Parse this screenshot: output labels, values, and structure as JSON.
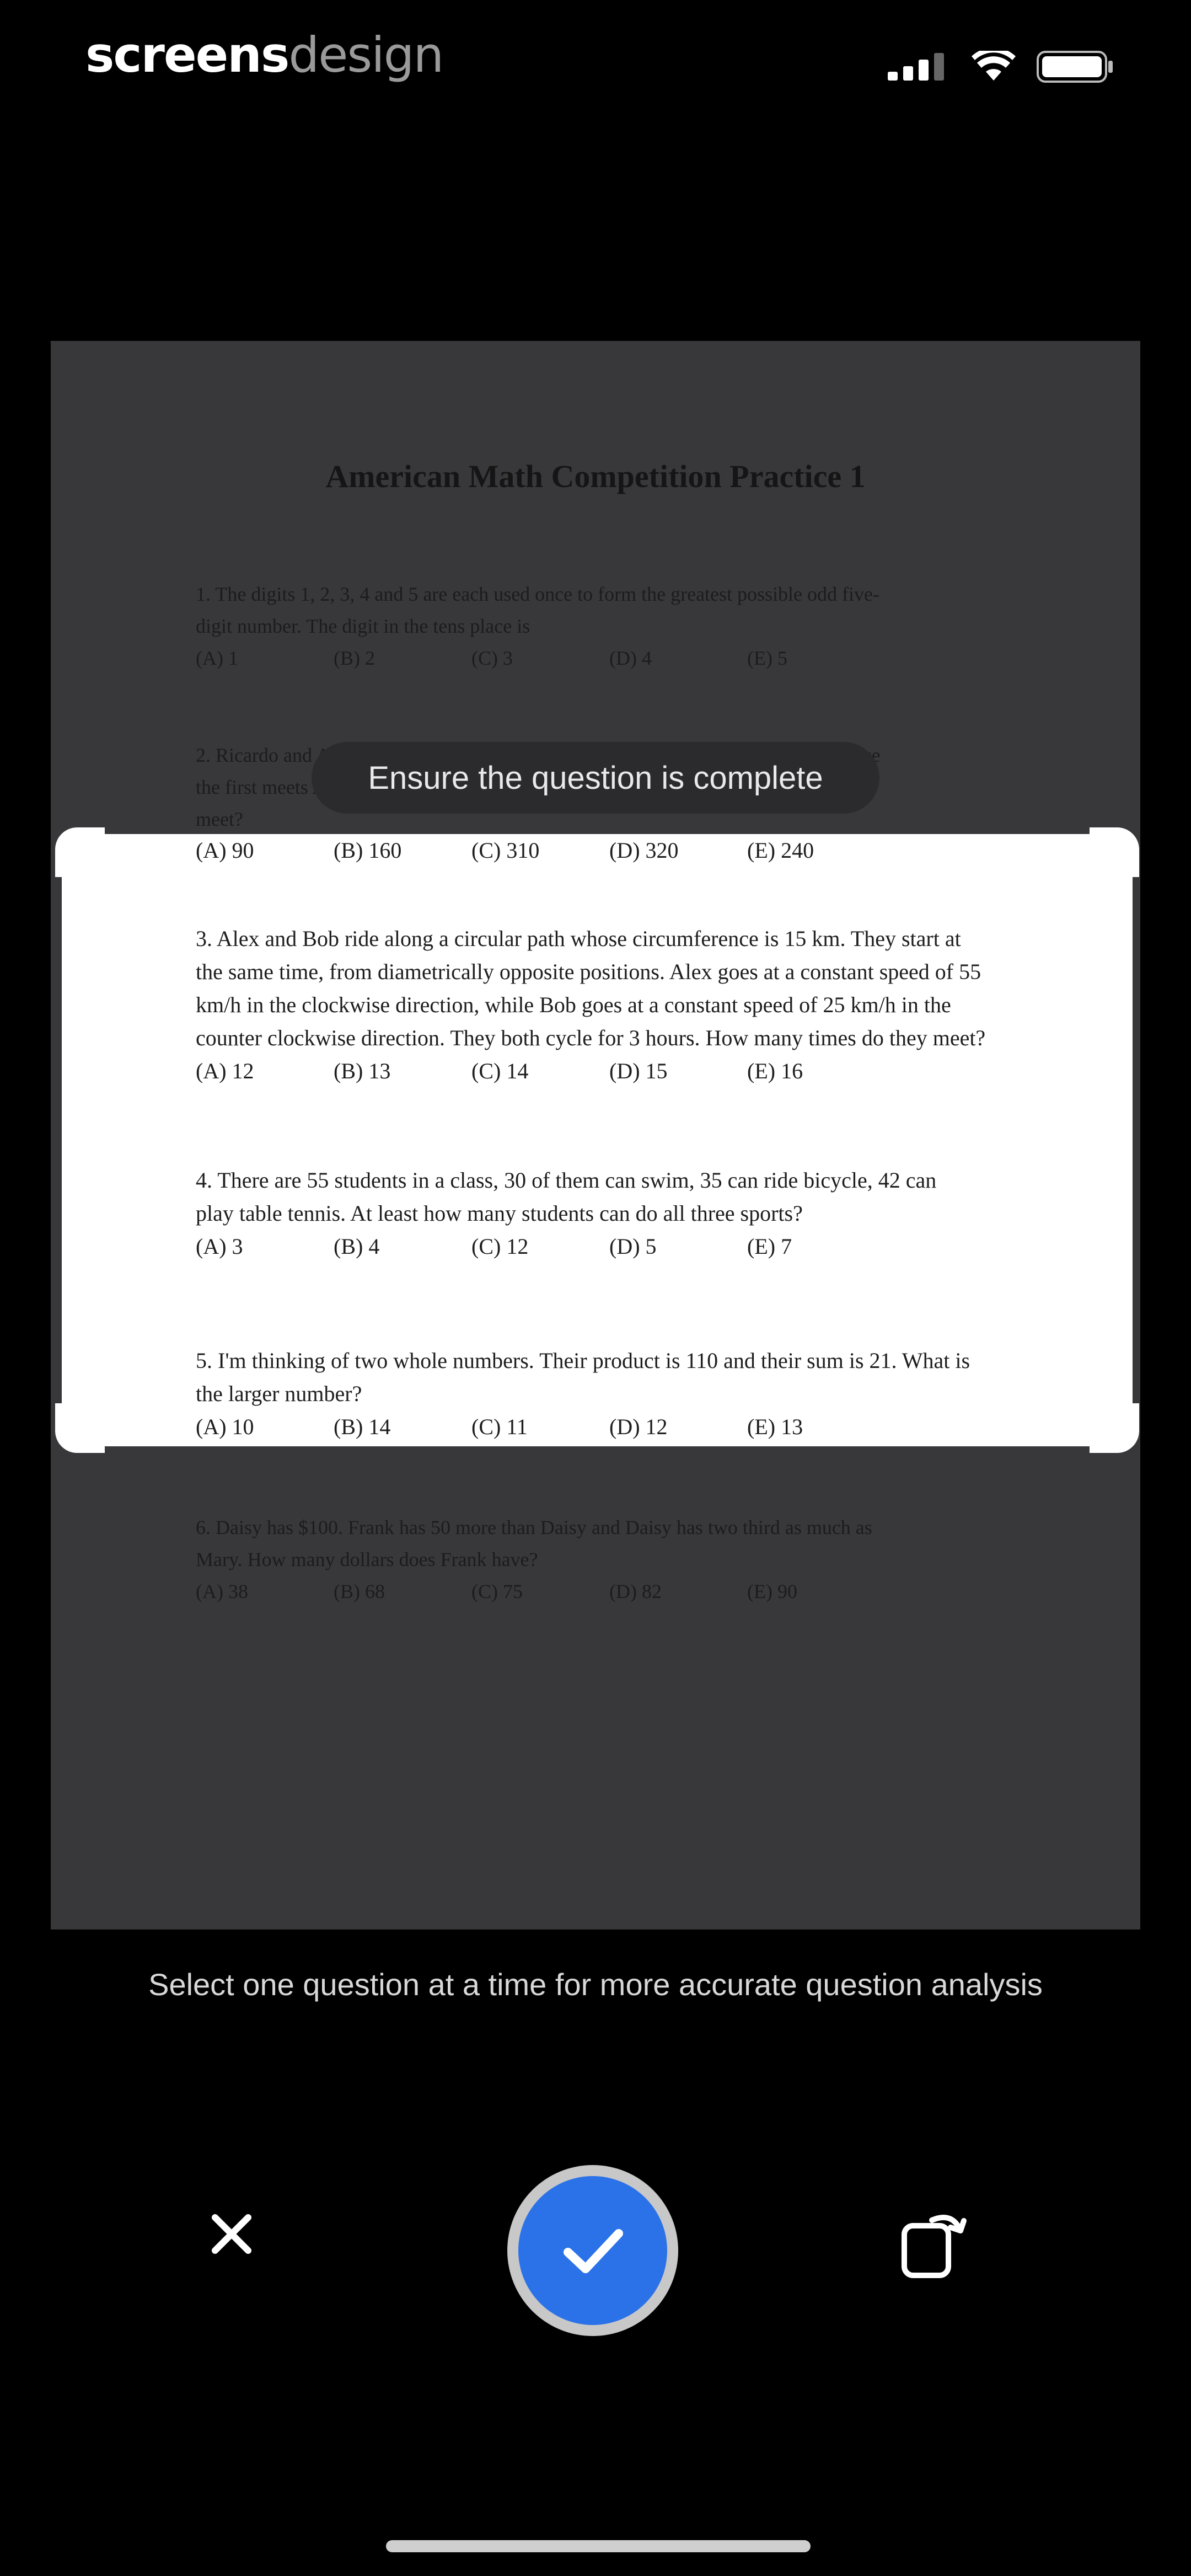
{
  "brand": {
    "part1": "screens",
    "part2": "design"
  },
  "status_bar": {
    "signal_icon": "signal-icon",
    "wifi_icon": "wifi-icon",
    "battery_icon": "battery-icon"
  },
  "document": {
    "title": "American Math Competition Practice 1",
    "questions": [
      {
        "lines": [
          "1. The digits 1, 2, 3, 4 and 5 are each used once to form the greatest possible odd five-",
          "digit number. The digit in the tens place is"
        ],
        "options": [
          "(A) 1",
          "(B) 2",
          "(C) 3",
          "(D) 4",
          "(E) 5"
        ]
      },
      {
        "lines": [
          "2. Ricardo and Anna start walking on the same path toward each other from a distance",
          "the first meets Anna after 10 minutes. What distance did they cover together before",
          "meet?"
        ],
        "options": [
          "(A) 90",
          "(B) 160",
          "(C) 310",
          "(D) 320",
          "(E) 240"
        ]
      },
      {
        "lines": [
          "3. Alex and Bob ride along a circular path whose circumference is 15 km. They start at",
          "the same time, from diametrically opposite positions. Alex goes at a constant speed of 55",
          "km/h in the clockwise direction, while Bob goes at a constant speed of 25 km/h in the",
          "counter clockwise direction. They both cycle for 3 hours. How many times do they meet?"
        ],
        "options": [
          "(A) 12",
          "(B) 13",
          "(C) 14",
          "(D) 15",
          "(E) 16"
        ]
      },
      {
        "lines": [
          "4. There are 55 students in a class, 30 of them can swim, 35 can ride bicycle, 42 can",
          "play table tennis. At least how many students can do all three sports?"
        ],
        "options": [
          "(A) 3",
          "(B) 4",
          "(C) 12",
          "(D) 5",
          "(E) 7"
        ]
      },
      {
        "lines": [
          "5. I'm thinking of two whole numbers. Their product is 110 and their sum is 21. What is",
          "the larger number?"
        ],
        "options": [
          "(A) 10",
          "(B) 14",
          "(C) 11",
          "(D) 12",
          "(E) 13"
        ]
      },
      {
        "lines": [
          "6. Daisy has $100. Frank has 50 more than Daisy and Daisy has two third as much as",
          "Mary. How many dollars does Frank have?"
        ],
        "options": [
          "(A) 38",
          "(B) 68",
          "(C) 75",
          "(D) 82",
          "(E) 90"
        ]
      }
    ]
  },
  "toast": "Ensure the question is complete",
  "hint": "Select one question at a time for more accurate question analysis",
  "controls": {
    "close_icon": "close-icon",
    "confirm_icon": "checkmark-icon",
    "rotate_icon": "rotate-icon"
  },
  "colors": {
    "accent": "#2b72e8",
    "background": "#000000",
    "document": "#38373a"
  }
}
